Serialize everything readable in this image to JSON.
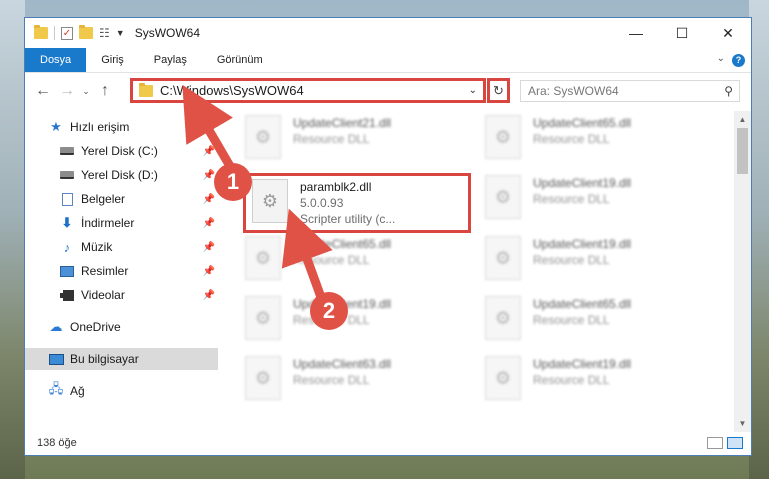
{
  "window": {
    "title": "SysWOW64",
    "controls": {
      "minimize": "—",
      "maximize": "☐",
      "close": "✕"
    }
  },
  "ribbon": {
    "tabs": [
      "Dosya",
      "Giriş",
      "Paylaş",
      "Görünüm"
    ],
    "active_tab": "Dosya"
  },
  "navbar": {
    "address": "C:\\Windows\\SysWOW64",
    "search_placeholder": "Ara: SysWOW64"
  },
  "sidebar": {
    "quick_access": "Hızlı erişim",
    "items": [
      {
        "label": "Yerel Disk (C:)",
        "pinned": true
      },
      {
        "label": "Yerel Disk (D:)",
        "pinned": true
      },
      {
        "label": "Belgeler",
        "pinned": true
      },
      {
        "label": "İndirmeler",
        "pinned": true
      },
      {
        "label": "Müzik",
        "pinned": true
      },
      {
        "label": "Resimler",
        "pinned": true
      },
      {
        "label": "Videolar",
        "pinned": true
      }
    ],
    "onedrive": "OneDrive",
    "this_pc": "Bu bilgisayar",
    "network": "Ağ"
  },
  "files": {
    "highlighted": {
      "name": "paramblk2.dll",
      "version": "5.0.0.93",
      "description": "Scripter utility (c..."
    },
    "left_column": [
      {
        "name": "UpdateClient21.dll",
        "type": "Resource DLL"
      },
      {
        "name": "UpdateClient65.dll",
        "type": "Resource DLL"
      },
      {
        "name": "UpdateClient19.dll",
        "type": "Resource DLL"
      },
      {
        "name": "UpdateClient63.dll",
        "type": "Resource DLL"
      }
    ],
    "right_column": [
      {
        "name": "UpdateClient65.dll",
        "type": "Resource DLL"
      },
      {
        "name": "UpdateClient19.dll",
        "type": "Resource DLL"
      },
      {
        "name": "UpdateClient19.dll",
        "type": "Resource DLL"
      },
      {
        "name": "UpdateClient65.dll",
        "type": "Resource DLL"
      },
      {
        "name": "UpdateClient19.dll",
        "type": "Resource DLL"
      }
    ]
  },
  "status": {
    "item_count": "138 öğe"
  },
  "annotations": {
    "step1": "1",
    "step2": "2",
    "color": "#e05246"
  }
}
